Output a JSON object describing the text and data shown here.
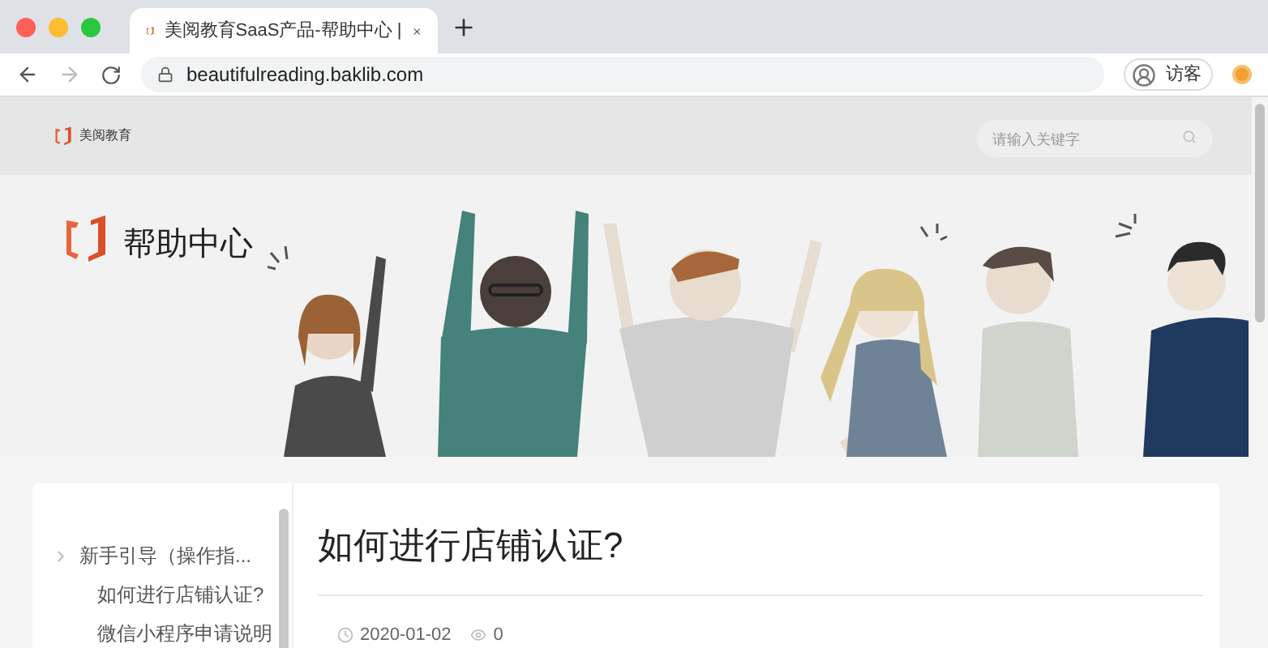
{
  "browser": {
    "tab": {
      "title": "美阅教育SaaS产品-帮助中心 |"
    },
    "url": "beautifulreading.baklib.com",
    "profile": "访客"
  },
  "site": {
    "brand": "美阅教育",
    "search": {
      "placeholder": "请输入关键字"
    }
  },
  "banner": {
    "title": "帮助中心"
  },
  "sidebar": {
    "items": [
      {
        "label": "新手引导（操作指...",
        "children": [
          {
            "label": "如何进行店铺认证?"
          },
          {
            "label": "微信小程序申请说明"
          }
        ]
      }
    ]
  },
  "article": {
    "title": "如何进行店铺认证?",
    "date": "2020-01-02",
    "views": "0"
  }
}
